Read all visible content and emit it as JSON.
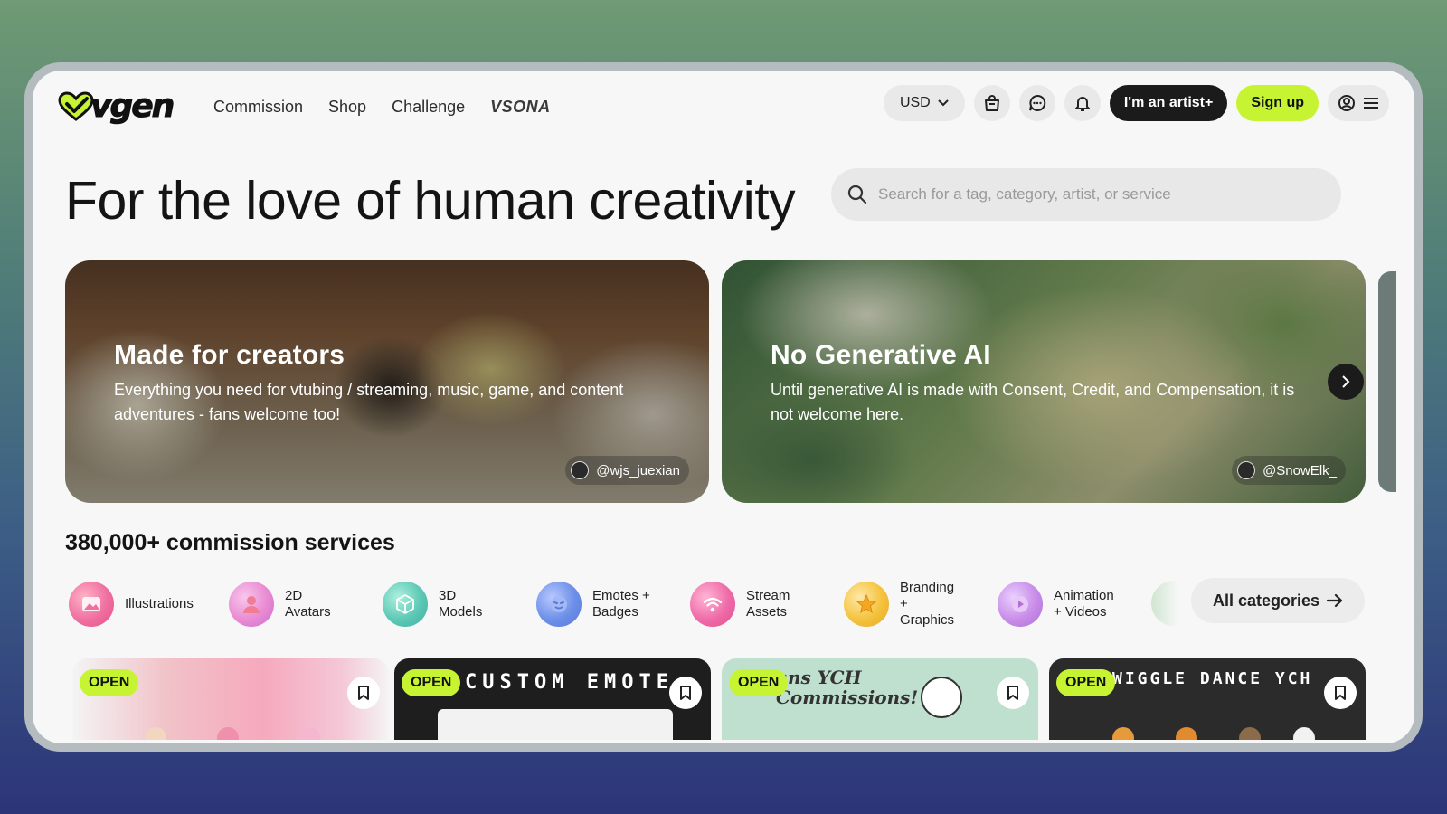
{
  "nav": {
    "brand": "vgen",
    "links": [
      "Commission",
      "Shop",
      "Challenge",
      "VSONA"
    ],
    "currency": "USD",
    "artist_label": "I'm an artist+",
    "signup_label": "Sign up"
  },
  "hero": {
    "title": "For the love of human creativity",
    "search_placeholder": "Search for a tag, category, artist, or service"
  },
  "banners": [
    {
      "title": "Made for creators",
      "text": "Everything you need for vtubing / streaming, music, game, and content adventures - fans welcome too!",
      "credit": "@wjs_juexian"
    },
    {
      "title": "No Generative AI",
      "text": "Until generative AI is made with Consent, Credit, and Compensation, it is not welcome here.",
      "credit": "@SnowElk_"
    }
  ],
  "services": {
    "title": "380,000+ commission services",
    "categories": [
      {
        "label": "Illustrations",
        "icon": "image-icon",
        "color": "#ef6fa0"
      },
      {
        "label": "2D\nAvatars",
        "icon": "person-icon",
        "color": "#e98ad2"
      },
      {
        "label": "3D\nModels",
        "icon": "cube-icon",
        "color": "#5cc8b5"
      },
      {
        "label": "Emotes +\nBadges",
        "icon": "smile-icon",
        "color": "#6c8fe8"
      },
      {
        "label": "Stream\nAssets",
        "icon": "signal-icon",
        "color": "#ef6aa8"
      },
      {
        "label": "Branding\n+\nGraphics",
        "icon": "star-icon",
        "color": "#f4c23c"
      },
      {
        "label": "Animation\n+ Videos",
        "icon": "play-icon",
        "color": "#c88ce8"
      }
    ],
    "all_label": "All categories"
  },
  "listings": [
    {
      "badge": "OPEN",
      "text": ""
    },
    {
      "badge": "OPEN",
      "text": "CUSTOM EMOTE"
    },
    {
      "badge": "OPEN",
      "text": "ans YCH\nCommissions!"
    },
    {
      "badge": "OPEN",
      "text": "WIGGLE DANCE YCH"
    }
  ],
  "colors": {
    "accent": "#c6f433",
    "dark": "#1b1b1b"
  }
}
